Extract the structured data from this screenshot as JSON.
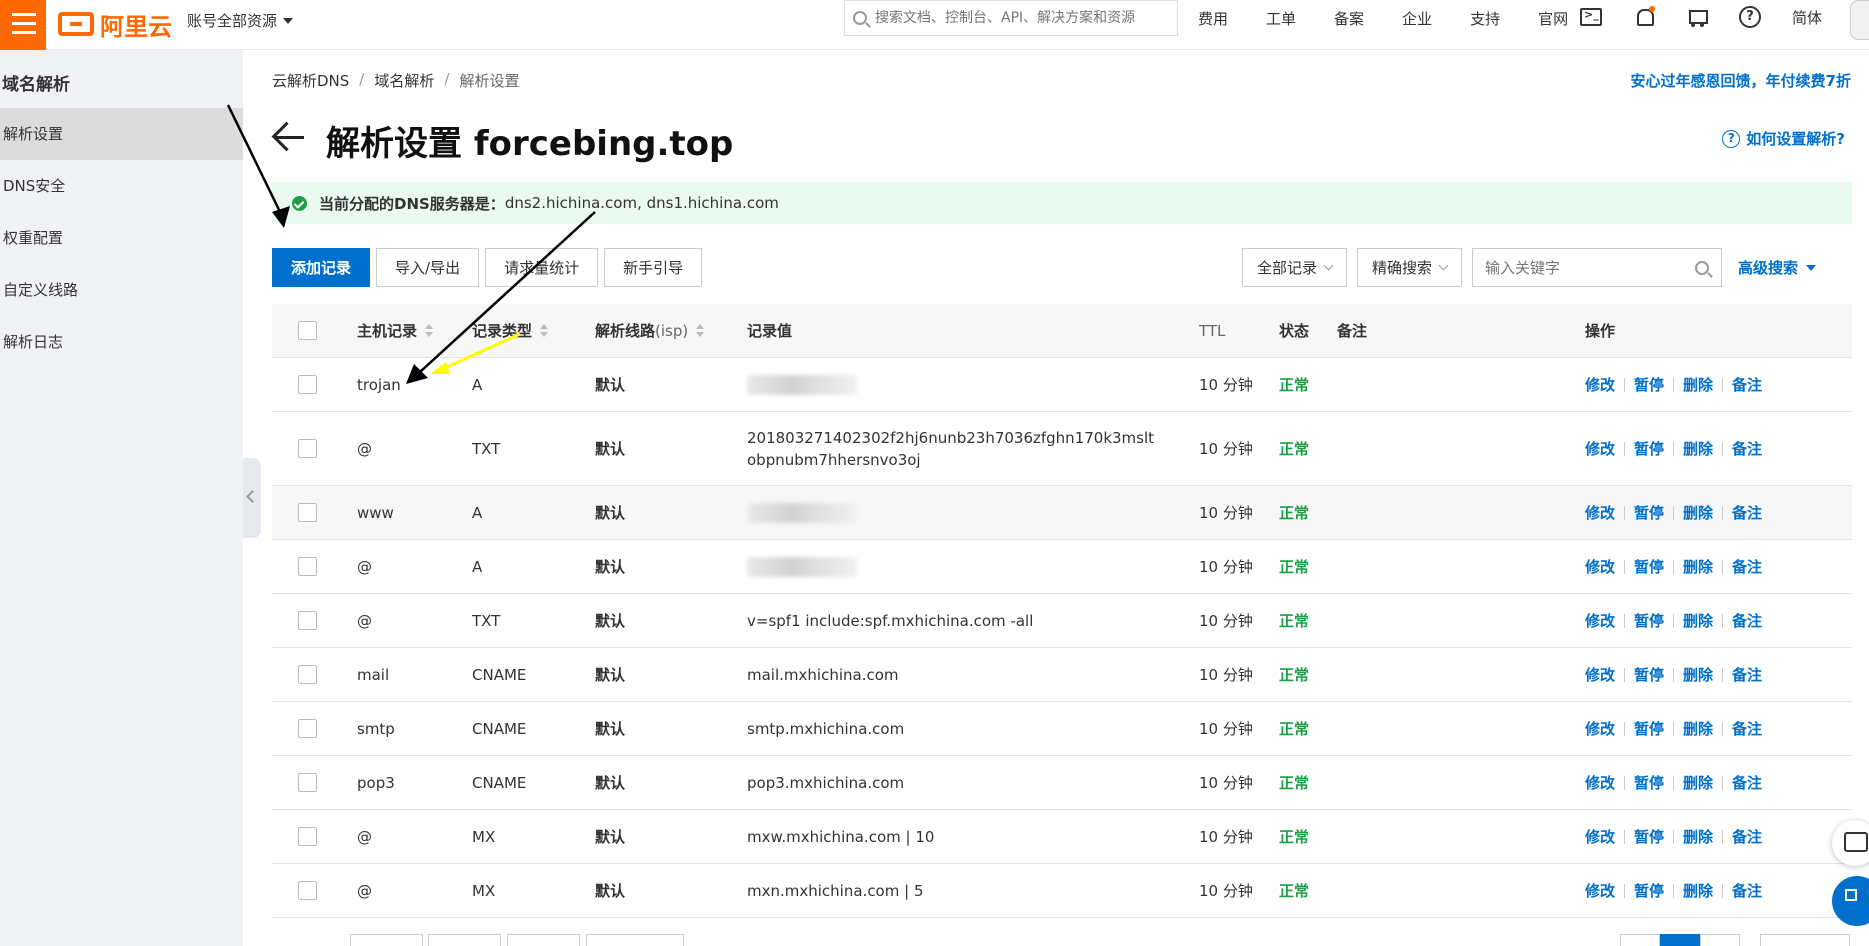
{
  "topbar": {
    "logo_text": "阿里云",
    "account": "账号全部资源",
    "search_placeholder": "搜索文档、控制台、API、解决方案和资源",
    "nav": [
      "费用",
      "工单",
      "备案",
      "企业",
      "支持",
      "官网"
    ],
    "lang": "简体",
    "brand_color": "#ff6a00"
  },
  "sidebar": {
    "title": "域名解析",
    "items": [
      "解析设置",
      "DNS安全",
      "权重配置",
      "自定义线路",
      "解析日志"
    ],
    "active_index": 0
  },
  "breadcrumb": [
    "云解析DNS",
    "域名解析",
    "解析设置"
  ],
  "promo": "安心过年感恩回馈，年付续费7折",
  "page": {
    "title": "解析设置 forcebing.top",
    "help_link": "如何设置解析?"
  },
  "notice": {
    "label": "当前分配的DNS服务器是：",
    "servers": "dns2.hichina.com, dns1.hichina.com"
  },
  "toolbar": {
    "add": "添加记录",
    "import_export": "导入/导出",
    "stats": "请求量统计",
    "guide": "新手引导"
  },
  "filters": {
    "all_records": "全部记录",
    "exact_search": "精确搜索",
    "keyword_placeholder": "输入关键字",
    "advanced": "高级搜索"
  },
  "table": {
    "headers": {
      "host": "主机记录",
      "type": "记录类型",
      "line": "解析线路",
      "line_suffix": "(isp)",
      "value": "记录值",
      "ttl": "TTL",
      "status": "状态",
      "remark": "备注",
      "ops": "操作"
    },
    "ops": [
      "修改",
      "暂停",
      "删除",
      "备注"
    ],
    "rows": [
      {
        "host": "trojan",
        "type": "A",
        "line": "默认",
        "value": "",
        "blurred": true,
        "ttl": "10 分钟",
        "status": "正常"
      },
      {
        "host": "@",
        "type": "TXT",
        "line": "默认",
        "value": "201803271402302f2hj6nunb23h7036zfghn170k3msltobpnubm7hhersnvo3oj",
        "blurred": false,
        "ttl": "10 分钟",
        "status": "正常"
      },
      {
        "host": "www",
        "type": "A",
        "line": "默认",
        "value": "",
        "blurred": true,
        "ttl": "10 分钟",
        "status": "正常"
      },
      {
        "host": "@",
        "type": "A",
        "line": "默认",
        "value": "",
        "blurred": true,
        "ttl": "10 分钟",
        "status": "正常"
      },
      {
        "host": "@",
        "type": "TXT",
        "line": "默认",
        "value": "v=spf1 include:spf.mxhichina.com -all",
        "blurred": false,
        "ttl": "10 分钟",
        "status": "正常"
      },
      {
        "host": "mail",
        "type": "CNAME",
        "line": "默认",
        "value": "mail.mxhichina.com",
        "blurred": false,
        "ttl": "10 分钟",
        "status": "正常"
      },
      {
        "host": "smtp",
        "type": "CNAME",
        "line": "默认",
        "value": "smtp.mxhichina.com",
        "blurred": false,
        "ttl": "10 分钟",
        "status": "正常"
      },
      {
        "host": "pop3",
        "type": "CNAME",
        "line": "默认",
        "value": "pop3.mxhichina.com",
        "blurred": false,
        "ttl": "10 分钟",
        "status": "正常"
      },
      {
        "host": "@",
        "type": "MX",
        "line": "默认",
        "value": "mxw.mxhichina.com | 10",
        "blurred": false,
        "ttl": "10 分钟",
        "status": "正常"
      },
      {
        "host": "@",
        "type": "MX",
        "line": "默认",
        "value": "mxn.mxhichina.com | 5",
        "blurred": false,
        "ttl": "10 分钟",
        "status": "正常"
      }
    ]
  },
  "colors": {
    "primary": "#0070cc",
    "ok": "#1e9e45",
    "notice_bg": "#eafaf0",
    "annotation_black": "#000000",
    "annotation_yellow": "#ffff00"
  }
}
